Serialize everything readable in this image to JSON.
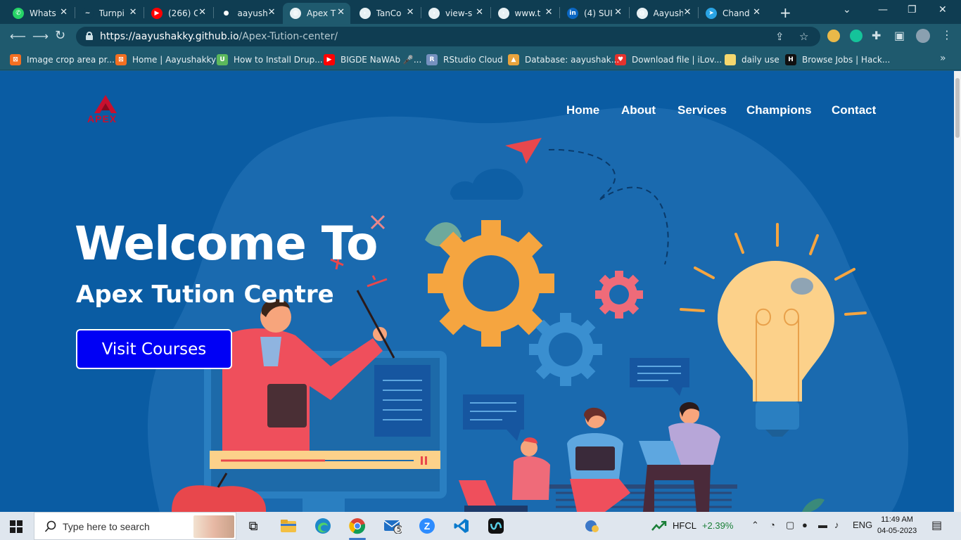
{
  "browser": {
    "tabs": [
      {
        "title": "Whats",
        "icon": "whatsapp-icon",
        "color": "#25d366"
      },
      {
        "title": "Turnpi",
        "icon": "turnpike-icon",
        "color": "#0f3d52"
      },
      {
        "title": "(266) C",
        "icon": "youtube-icon",
        "color": "#ff0000"
      },
      {
        "title": "aayush",
        "icon": "github-icon",
        "color": "#0f3d52"
      },
      {
        "title": "Apex T",
        "icon": "globe-icon",
        "color": "#e7f0f3"
      },
      {
        "title": "TanCo",
        "icon": "terminal-icon",
        "color": "#e7f0f3"
      },
      {
        "title": "view-s",
        "icon": "terminal-icon",
        "color": "#e7f0f3"
      },
      {
        "title": "www.t",
        "icon": "terminal-icon",
        "color": "#e7f0f3"
      },
      {
        "title": "(4) SUI",
        "icon": "linkedin-icon",
        "color": "#0a66c2"
      },
      {
        "title": "Aayush",
        "icon": "globe-icon",
        "color": "#e7f0f3"
      },
      {
        "title": "Chand",
        "icon": "telegram-icon",
        "color": "#2aa3e3"
      }
    ],
    "active_tab_index": 4,
    "url_host": "https://aayushakky.github.io",
    "url_path": "/Apex-Tution-center/"
  },
  "bookmarks": [
    {
      "label": "Image crop area pr...",
      "color": "#f36f21",
      "glyph": "⊠"
    },
    {
      "label": "Home | Aayushakky",
      "color": "#f36f21",
      "glyph": "⊠"
    },
    {
      "label": "How to Install Drup...",
      "color": "#5cb85c",
      "glyph": "U"
    },
    {
      "label": "BIGDE NaWAb 🎤...",
      "color": "#ff0000",
      "glyph": "▶"
    },
    {
      "label": "RStudio Cloud",
      "color": "#7591bf",
      "glyph": "R"
    },
    {
      "label": "Database: aayushak...",
      "color": "#e8a33d",
      "glyph": "▲"
    },
    {
      "label": "Download file | iLov...",
      "color": "#e5322d",
      "glyph": "♥"
    },
    {
      "label": "daily use",
      "color": "#f5d76e",
      "glyph": ""
    },
    {
      "label": "Browse Jobs | Hack...",
      "color": "#111111",
      "glyph": "H"
    }
  ],
  "site": {
    "logo_text": "APEX",
    "nav": [
      "Home",
      "About",
      "Services",
      "Champions",
      "Contact"
    ],
    "hero_title": "Welcome To",
    "hero_subtitle": "Apex Tution Centre",
    "cta_label": "Visit Courses"
  },
  "taskbar": {
    "search_placeholder": "Type here to search",
    "mail_badge": "5",
    "stock_name": "HFCL",
    "stock_change": "+2.39%",
    "language": "ENG",
    "time": "11:49 AM",
    "date": "04-05-2023"
  },
  "colors": {
    "page_bg": "#0a5ca3",
    "cta_bg": "#0000f5",
    "browser_frame": "#1f5a6e"
  }
}
